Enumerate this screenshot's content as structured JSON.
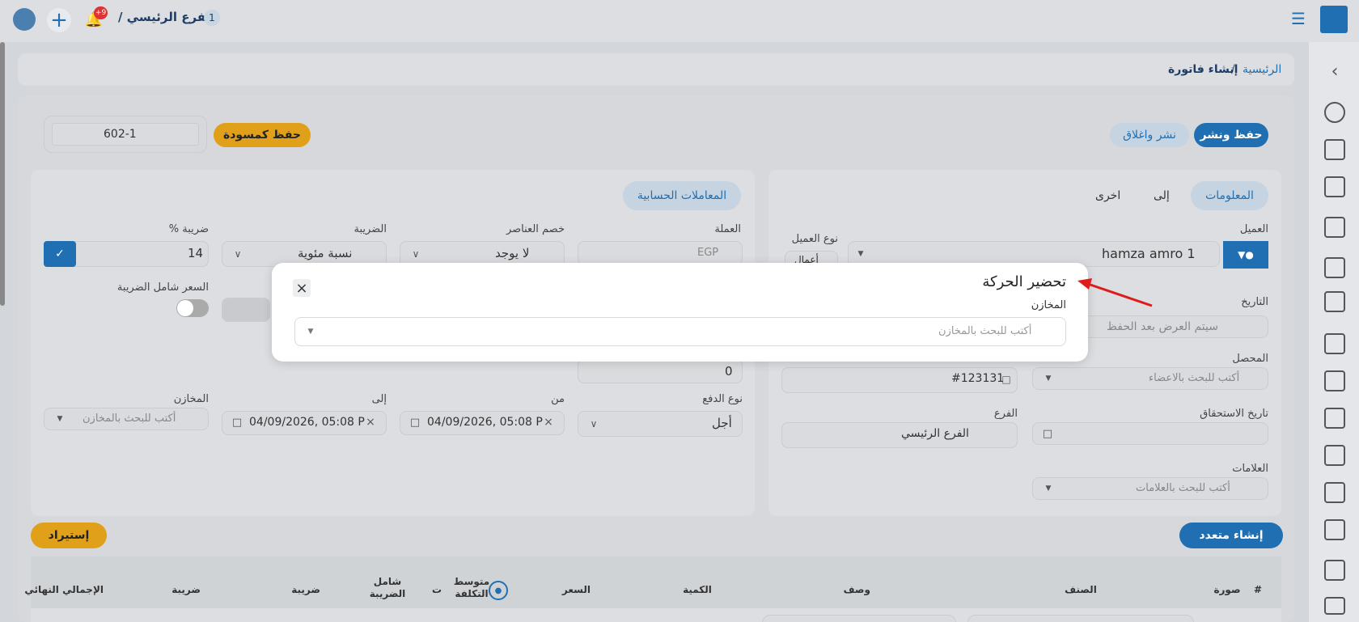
{
  "topbar": {
    "branch_label": "الفرع الرئيسي /",
    "branch_count": "1",
    "notif_badge": "+9"
  },
  "breadcrumb": {
    "home": "الرئيسية",
    "sep": "/",
    "current": "إنشاء فاتورة"
  },
  "actions": {
    "save_publish": "حفظ ونشر",
    "publish_close": "نشر واغلاق",
    "save_draft": "حفظ كمسودة",
    "invoice_no": "602-1"
  },
  "left_panel": {
    "tab": "المعاملات الحسابية",
    "currency_label": "العملة",
    "currency_value": "EGP",
    "items_discount_label": "خصم العناصر",
    "items_discount_value": "لا يوجد",
    "tax_label": "الضريبة",
    "tax_value": "نسبة مئوية",
    "tax_pct_label": "ضريبة %",
    "tax_pct_value": "14",
    "price_incl_tax_label": "السعر شامل الضريبة",
    "zero_value": "0",
    "payment_type_label": "نوع الدفع",
    "payment_type_value": "أجل",
    "from_label": "من",
    "from_value": "04/09/2026, 05:08 P",
    "to_label": "إلى",
    "to_value": "04/09/2026, 05:08 P",
    "stores_label": "المخازن",
    "stores_placeholder": "أكتب للبحث بالمخازن"
  },
  "right_panel": {
    "tabs": [
      "المعلومات",
      "إلى",
      "اخرى"
    ],
    "client_label": "العميل",
    "client_value": "hamza amro 1",
    "client_type_label": "نوع العميل",
    "client_type_value": "أعمال",
    "date_label": "التاريخ",
    "date_placeholder": "سيتم العرض بعد الحفظ",
    "collector_label": "المحصل",
    "collector_placeholder": "أكتب للبحث بالاعضاء",
    "ref_value": "#123131",
    "due_date_label": "تاريخ الاستحقاق",
    "branch_label": "الفرع",
    "branch_value": "الفرع الرئيسي",
    "tags_label": "العلامات",
    "tags_placeholder": "أكتب للبحث بالعلامات"
  },
  "table_actions": {
    "create_multi": "إنشاء متعدد",
    "import": "إستيراد"
  },
  "table_headers": [
    "#",
    "صورة",
    "الصنف",
    "وصف",
    "الكمية",
    "السعر",
    "متوسط التكلفة",
    "ت",
    "شامل الضريبة",
    "ضريبة",
    "ضريبة",
    "الإجمالي النهائي"
  ],
  "modal": {
    "title": "تحضير الحركة",
    "stores_label": "المخازن",
    "stores_placeholder": "أكتب للبحث بالمخازن"
  },
  "colors": {
    "primary": "#1f6fb2",
    "draft": "#e0a019",
    "bg": "#d3d6da"
  }
}
